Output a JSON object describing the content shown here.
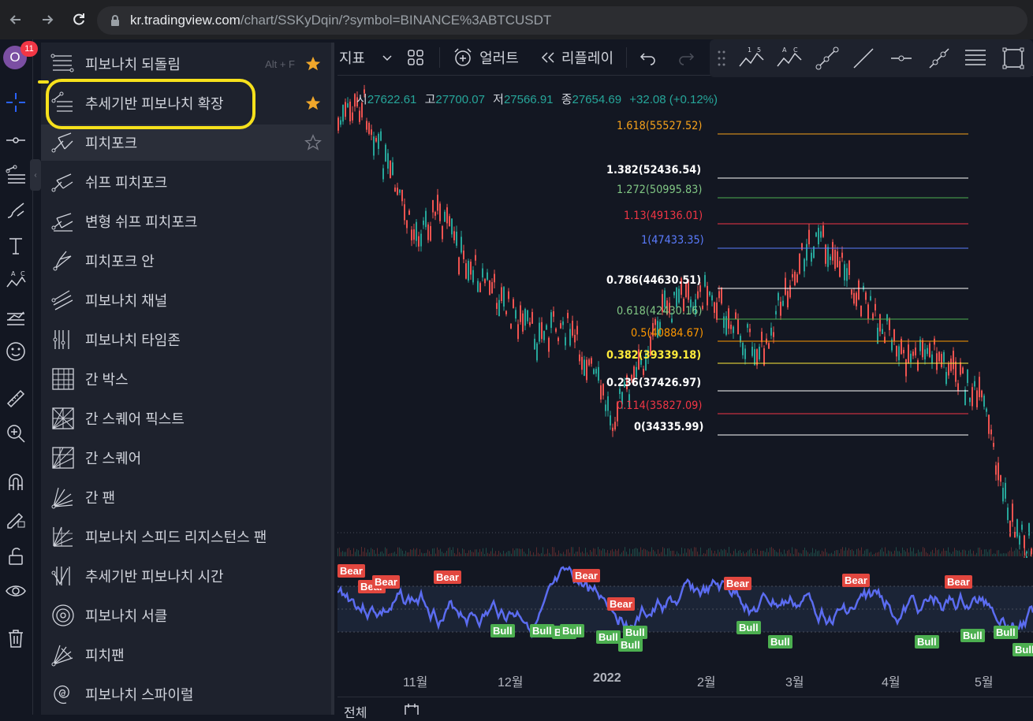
{
  "browser": {
    "url_host": "kr.tradingview.com",
    "url_path": "/chart/SSKyDqin/?symbol=BINANCE%3ABTCUSDT"
  },
  "account": {
    "avatar_letter": "O",
    "notification_count": "11"
  },
  "menu": {
    "items": [
      {
        "label": "피보나치 되돌림",
        "shortcut": "Alt + F",
        "starred": true,
        "icon": "fib-retracement-icon"
      },
      {
        "label": "추세기반 피보나치 확장",
        "shortcut": "",
        "starred": true,
        "icon": "trend-fib-extension-icon"
      },
      {
        "label": "피치포크",
        "shortcut": "",
        "starred": false,
        "icon": "pitchfork-icon"
      },
      {
        "label": "쉬프 피치포크",
        "shortcut": "",
        "starred": null,
        "icon": "schiff-pitchfork-icon"
      },
      {
        "label": "변형 쉬프 피치포크",
        "shortcut": "",
        "starred": null,
        "icon": "modified-schiff-pitchfork-icon"
      },
      {
        "label": "피치포크 안",
        "shortcut": "",
        "starred": null,
        "icon": "inside-pitchfork-icon"
      },
      {
        "label": "피보나치 채널",
        "shortcut": "",
        "starred": null,
        "icon": "fib-channel-icon"
      },
      {
        "label": "피보나치 타임존",
        "shortcut": "",
        "starred": null,
        "icon": "fib-timezone-icon"
      },
      {
        "label": "간 박스",
        "shortcut": "",
        "starred": null,
        "icon": "gann-box-icon"
      },
      {
        "label": "간 스퀘어 픽스트",
        "shortcut": "",
        "starred": null,
        "icon": "gann-square-fixed-icon"
      },
      {
        "label": "간 스퀘어",
        "shortcut": "",
        "starred": null,
        "icon": "gann-square-icon"
      },
      {
        "label": "간 팬",
        "shortcut": "",
        "starred": null,
        "icon": "gann-fan-icon"
      },
      {
        "label": "피보나치 스피드 리지스턴스 팬",
        "shortcut": "",
        "starred": null,
        "icon": "fib-speed-fan-icon"
      },
      {
        "label": "추세기반 피보나치 시간",
        "shortcut": "",
        "starred": null,
        "icon": "trend-fib-time-icon"
      },
      {
        "label": "피보나치 서클",
        "shortcut": "",
        "starred": null,
        "icon": "fib-circles-icon"
      },
      {
        "label": "피치팬",
        "shortcut": "",
        "starred": null,
        "icon": "pitchfan-icon"
      },
      {
        "label": "피보나치 스파이럴",
        "shortcut": "",
        "starred": null,
        "icon": "fib-spiral-icon"
      }
    ]
  },
  "top_toolbar": {
    "indicators_label": "지표",
    "alert_label": "얼러트",
    "replay_label": "리플레이"
  },
  "ohlc": {
    "open_key": "시",
    "open": "27622.61",
    "high_key": "고",
    "high": "27700.07",
    "low_key": "저",
    "low": "27566.91",
    "close_key": "종",
    "close": "27654.69",
    "change": "+32.08 (+0.12%)"
  },
  "fib_levels": [
    {
      "label": "1.618(55527.52)",
      "color": "#f7a21b",
      "line": "#f7a21b"
    },
    {
      "label": "1.382(52436.54)",
      "color": "#ffffff",
      "line": "#ffffff"
    },
    {
      "label": "1.272(50995.83)",
      "color": "#81c784",
      "line": "#4caf50"
    },
    {
      "label": "1.13(49136.01)",
      "color": "#f23645",
      "line": "#f23645"
    },
    {
      "label": "1(47433.35)",
      "color": "#5b7cff",
      "line": "#5b7cff"
    },
    {
      "label": "0.786(44630.51)",
      "color": "#ffffff",
      "line": "#ffffff"
    },
    {
      "label": "0.618(42430.16)",
      "color": "#81c784",
      "line": "#4caf50"
    },
    {
      "label": "0.5(40884.67)",
      "color": "#ff9800",
      "line": "#ff9800"
    },
    {
      "label": "0.382(39339.18)",
      "color": "#ffeb3b",
      "line": "#ffeb3b"
    },
    {
      "label": "0.236(37426.97)",
      "color": "#ffffff",
      "line": "#ffffff"
    },
    {
      "label": "0.114(35827.09)",
      "color": "#f23645",
      "line": "#f23645"
    },
    {
      "label": "0(34335.99)",
      "color": "#ffffff",
      "line": "#ffffff"
    }
  ],
  "time_axis": [
    "11월",
    "12월",
    "2022",
    "2월",
    "3월",
    "4월",
    "5월"
  ],
  "bottom": {
    "range_label": "전체"
  },
  "oscillator": {
    "bear_label": "Bear",
    "bull_label": "Bull"
  }
}
